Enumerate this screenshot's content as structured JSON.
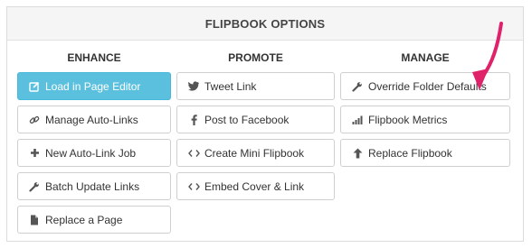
{
  "panel": {
    "title": "FLIPBOOK OPTIONS"
  },
  "columns": [
    {
      "title": "ENHANCE",
      "buttons": [
        {
          "label": "Load in Page Editor",
          "icon": "edit-icon"
        },
        {
          "label": "Manage Auto-Links",
          "icon": "link-icon"
        },
        {
          "label": "New Auto-Link Job",
          "icon": "plus-icon"
        },
        {
          "label": "Batch Update Links",
          "icon": "wrench-icon"
        },
        {
          "label": "Replace a Page",
          "icon": "file-icon"
        }
      ]
    },
    {
      "title": "PROMOTE",
      "buttons": [
        {
          "label": "Tweet Link",
          "icon": "twitter-icon"
        },
        {
          "label": "Post to Facebook",
          "icon": "facebook-icon"
        },
        {
          "label": "Create Mini Flipbook",
          "icon": "code-icon"
        },
        {
          "label": "Embed Cover & Link",
          "icon": "code-icon"
        }
      ]
    },
    {
      "title": "MANAGE",
      "buttons": [
        {
          "label": "Override Folder Defaults",
          "icon": "wrench-icon"
        },
        {
          "label": "Flipbook Metrics",
          "icon": "signal-icon"
        },
        {
          "label": "Replace Flipbook",
          "icon": "arrow-up-icon"
        }
      ]
    }
  ],
  "colors": {
    "primary": "#5bc0de",
    "annotation_arrow": "#e0226b"
  }
}
